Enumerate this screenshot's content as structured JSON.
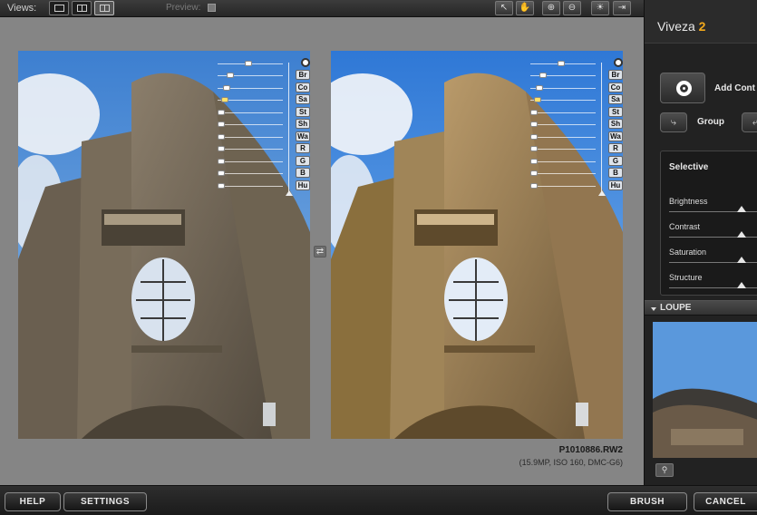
{
  "toolbar": {
    "views_label": "Views:",
    "preview_label": "Preview:",
    "tools": [
      "hand-icon",
      "grab-icon",
      "zoom-in-icon",
      "zoom-out-icon",
      "light-icon",
      "fit-icon"
    ]
  },
  "canvas": {
    "filename": "P1010886.RW2",
    "fileinfo": "(15.9MP, ISO 160, DMC-G6)"
  },
  "control_point": {
    "labels": [
      "Br",
      "Co",
      "Sa",
      "St",
      "Sh",
      "Wa",
      "R",
      "G",
      "B",
      "Hu"
    ]
  },
  "panel": {
    "app_name": "Viveza",
    "app_version": "2",
    "add_control_point_label": "Add Cont",
    "group_label": "Group",
    "selective_title": "Selective",
    "selective_sliders": [
      {
        "label": "Brightness"
      },
      {
        "label": "Contrast"
      },
      {
        "label": "Saturation"
      },
      {
        "label": "Structure"
      }
    ],
    "loupe_label": "LOUPE"
  },
  "bottom": {
    "help": "HELP",
    "settings": "SETTINGS",
    "brush": "BRUSH",
    "cancel": "CANCEL"
  },
  "colors": {
    "accent": "#f3a91b",
    "canvas": "#858585",
    "sky": "#4f8ed6"
  }
}
